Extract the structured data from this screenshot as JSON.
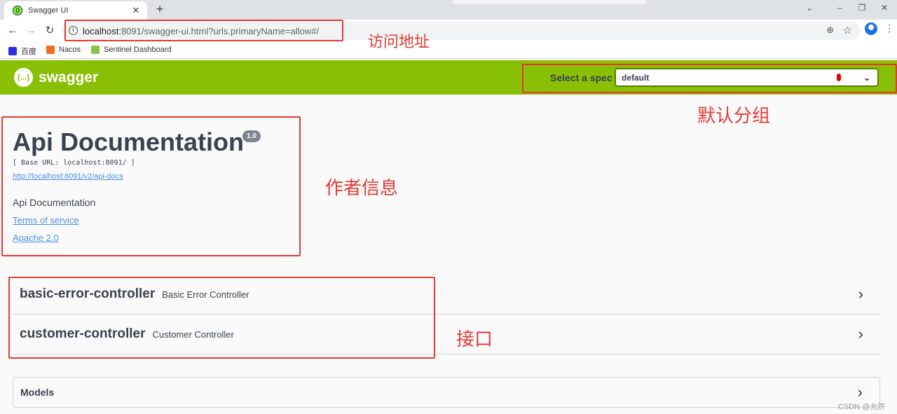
{
  "browser": {
    "tab_title": "Swagger UI",
    "tab_favicon": "swagger-favicon",
    "url_host": "localhost",
    "url_rest": ":8091/swagger-ui.html?urls.primaryName=allow#/",
    "bookmarks": [
      {
        "label": "百度",
        "icon": "baidu-icon"
      },
      {
        "label": "Nacos",
        "icon": "nacos-icon"
      },
      {
        "label": "Sentinel Dashboard",
        "icon": "sentinel-icon"
      }
    ]
  },
  "topbar": {
    "logo_text": "swagger",
    "logo_mark": "{...}",
    "spec_label": "Select a spec",
    "spec_value": "default"
  },
  "info": {
    "title": "Api Documentation",
    "version": "1.0",
    "base_url": "[ Base URL: localhost:8091/ ]",
    "api_docs_url": "http://localhost:8091/v2/api-docs",
    "description": "Api Documentation",
    "terms_label": "Terms of service",
    "license_label": "Apache 2.0"
  },
  "operations": [
    {
      "name": "basic-error-controller",
      "description": "Basic Error Controller"
    },
    {
      "name": "customer-controller",
      "description": "Customer Controller"
    }
  ],
  "models": {
    "label": "Models"
  },
  "annotations": {
    "address": "访问地址",
    "default_group": "默认分组",
    "author_info": "作者信息",
    "interface": "接口"
  },
  "watermark": "CSDN @允許",
  "colors": {
    "swagger_green": "#89bf04",
    "annotation_red": "#e53935",
    "link_blue": "#4990e2"
  }
}
